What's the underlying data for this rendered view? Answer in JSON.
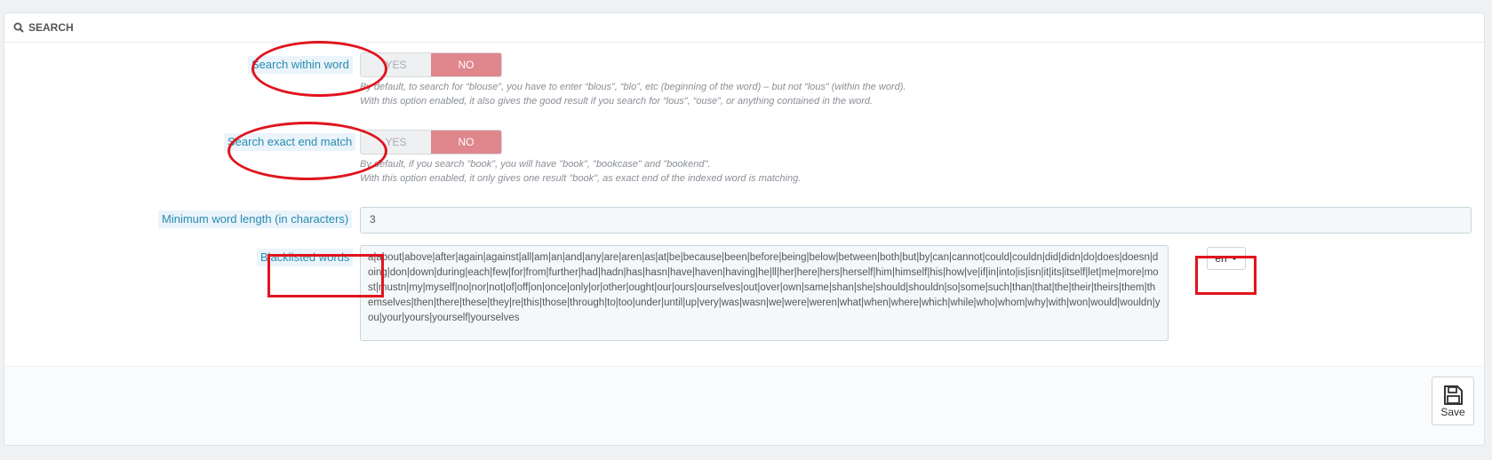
{
  "panel": {
    "title": "SEARCH",
    "icon": "search-icon"
  },
  "fields": {
    "search_within_word": {
      "label": "Search within word",
      "yes": "YES",
      "no": "NO",
      "value": "NO",
      "help1": "By default, to search for “blouse”, you have to enter “blous”, “blo”, etc (beginning of the word) – but not “lous” (within the word).",
      "help2": "With this option enabled, it also gives the good result if you search for “lous”, “ouse”, or anything contained in the word."
    },
    "search_exact_end_match": {
      "label": "Search exact end match",
      "yes": "YES",
      "no": "NO",
      "value": "NO",
      "help1": "By default, if you search \"book\", you will have \"book\", \"bookcase\" and \"bookend\".",
      "help2": "With this option enabled, it only gives one result \"book\", as exact end of the indexed word is matching."
    },
    "min_word_length": {
      "label": "Minimum word length (in characters)",
      "value": "3"
    },
    "blacklisted_words": {
      "label": "Blacklisted words",
      "value": "a|about|above|after|again|against|all|am|an|and|any|are|aren|as|at|be|because|been|before|being|below|between|both|but|by|can|cannot|could|couldn|did|didn|do|does|doesn|doing|don|down|during|each|few|for|from|further|had|hadn|has|hasn|have|haven|having|he|ll|her|here|hers|herself|him|himself|his|how|ve|if|in|into|is|isn|it|its|itself|let|me|more|most|mustn|my|myself|no|nor|not|of|off|on|once|only|or|other|ought|our|ours|ourselves|out|over|own|same|shan|she|should|shouldn|so|some|such|than|that|the|their|theirs|them|themselves|then|there|these|they|re|this|those|through|to|too|under|until|up|very|was|wasn|we|were|weren|what|when|where|which|while|who|whom|why|with|won|would|wouldn|you|your|yours|yourself|yourselves",
      "language": "en"
    }
  },
  "footer": {
    "save_label": "Save"
  },
  "colors": {
    "annotation": "#e0141e",
    "switch_no": "#e0868d",
    "label_blue": "#2a8bb0"
  }
}
